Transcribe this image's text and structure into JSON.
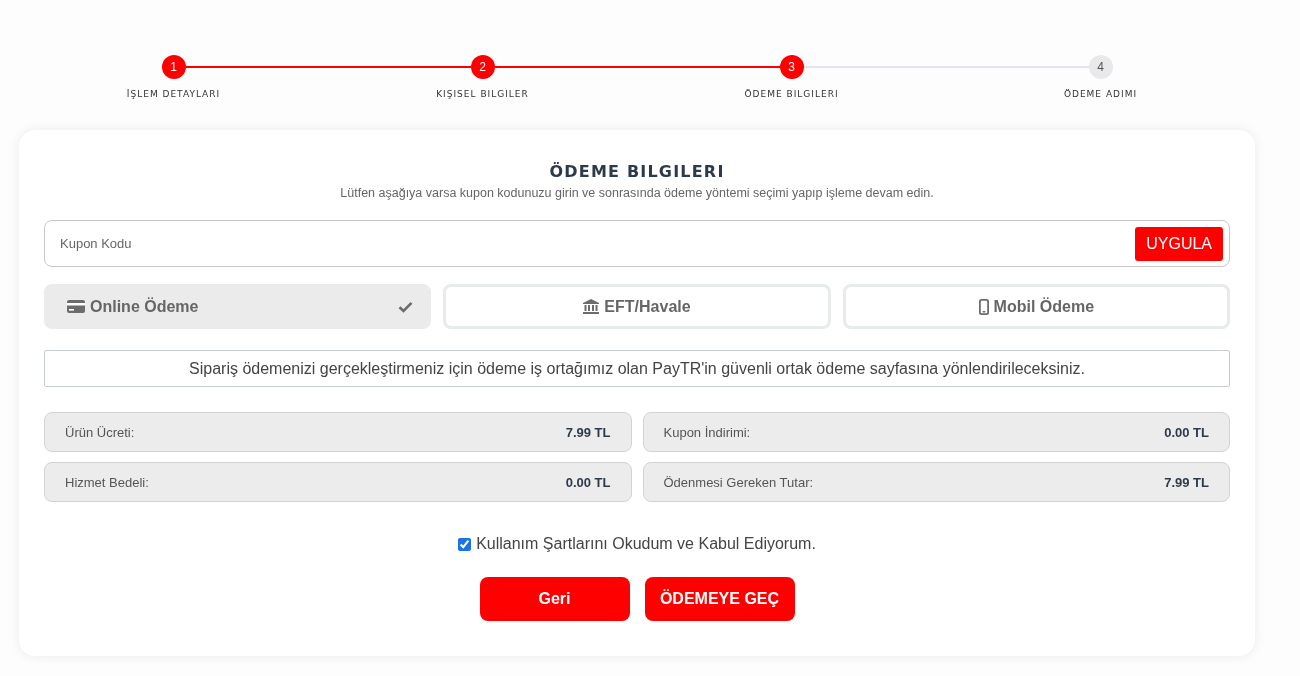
{
  "steps": [
    {
      "number": "1",
      "label": "İŞLEM DETAYLARI",
      "done": true
    },
    {
      "number": "2",
      "label": "KIŞISEL BILGILER",
      "done": true
    },
    {
      "number": "3",
      "label": "ÖDEME BILGILERI",
      "done": true
    },
    {
      "number": "4",
      "label": "ÖDEME ADIMI",
      "done": false
    }
  ],
  "payment": {
    "title": "ÖDEME BILGILERI",
    "subtitle": "Lütfen aşağıya varsa kupon kodunuzu girin ve sonrasında ödeme yöntemi seçimi yapıp işleme devam edin.",
    "coupon": {
      "placeholder": "Kupon Kodu",
      "button": "UYGULA"
    },
    "methods": [
      {
        "label": "Online Ödeme",
        "kind": "card",
        "selected": true
      },
      {
        "label": "EFT/Havale",
        "kind": "bank",
        "selected": false
      },
      {
        "label": "Mobil Ödeme",
        "kind": "mobile",
        "selected": false
      }
    ],
    "notice": "Sipariş ödemenizi gerçekleştirmeniz için ödeme iş ortağımız olan PayTR'in güvenli ortak ödeme sayfasına yönlendirileceksiniz.",
    "summary": [
      {
        "label": "Ürün Ücreti:",
        "value": "7.99 TL"
      },
      {
        "label": "Kupon İndirimi:",
        "value": "0.00 TL"
      },
      {
        "label": "Hizmet Bedeli:",
        "value": "0.00 TL"
      },
      {
        "label": "Ödenmesi Gereken Tutar:",
        "value": "7.99 TL"
      }
    ],
    "terms": {
      "label": "Kullanım Şartlarını Okudum ve Kabul Ediyorum.",
      "checked": true
    },
    "buttons": [
      {
        "label": "Geri"
      },
      {
        "label": "ÖDEMEYE GEÇ"
      }
    ]
  }
}
